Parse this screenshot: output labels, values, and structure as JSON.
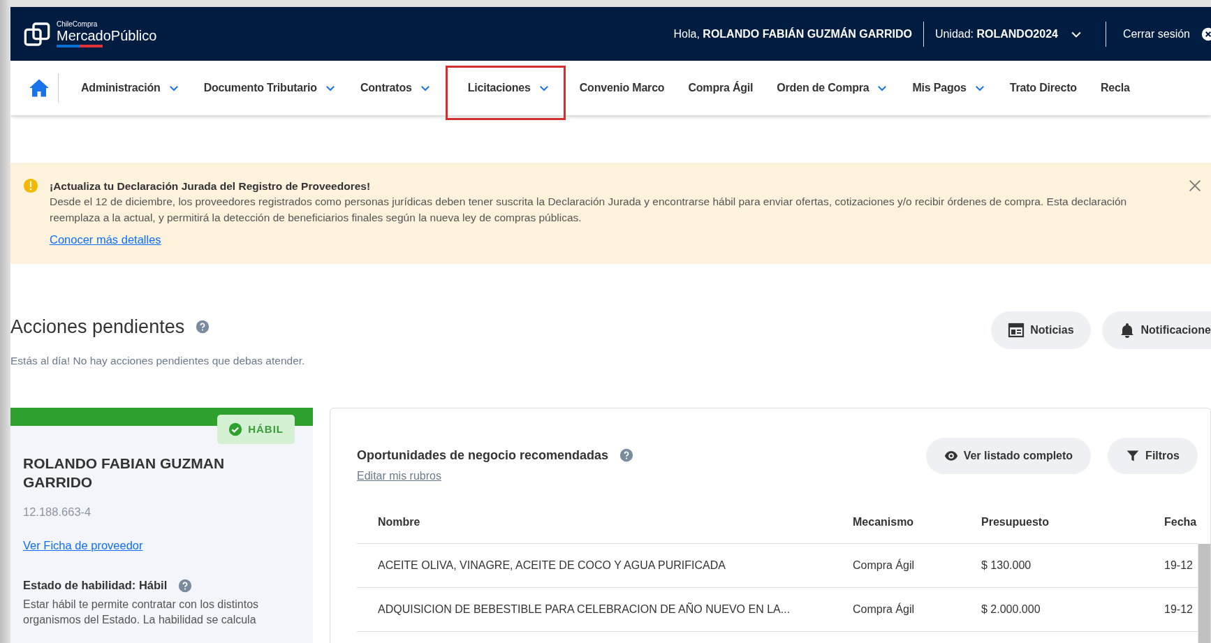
{
  "header": {
    "logo_top": "ChileCompra",
    "logo_name": "MercadoPúblico",
    "greeting": "Hola,",
    "user": "ROLANDO FABIÁN GUZMÁN GARRIDO",
    "unit_label": "Unidad:",
    "unit": "ROLANDO2024",
    "logout": "Cerrar sesión"
  },
  "nav": {
    "items": [
      {
        "label": "Administración",
        "dropdown": true,
        "highlighted": false
      },
      {
        "label": "Documento Tributario",
        "dropdown": true,
        "highlighted": false
      },
      {
        "label": "Contratos",
        "dropdown": true,
        "highlighted": false
      },
      {
        "label": "Licitaciones",
        "dropdown": true,
        "highlighted": true
      },
      {
        "label": "Convenio Marco",
        "dropdown": false,
        "highlighted": false
      },
      {
        "label": "Compra Ágil",
        "dropdown": false,
        "highlighted": false
      },
      {
        "label": "Orden de Compra",
        "dropdown": true,
        "highlighted": false
      },
      {
        "label": "Mis Pagos",
        "dropdown": true,
        "highlighted": false
      },
      {
        "label": "Trato Directo",
        "dropdown": false,
        "highlighted": false
      },
      {
        "label": "Recla",
        "dropdown": false,
        "highlighted": false
      }
    ]
  },
  "alert": {
    "title": "¡Actualiza tu Declaración Jurada del Registro de Proveedores!",
    "text": "Desde el 12 de diciembre, los proveedores registrados como personas jurídicas deben tener suscrita la Declaración Jurada y encontrarse hábil para enviar ofertas, cotizaciones y/o recibir órdenes de compra. Esta declaración reemplaza a la actual, y permitirá la detección de beneficiarios finales según la nueva ley de compras públicas.",
    "link": "Conocer más detalles"
  },
  "pending": {
    "title": "Acciones pendientes",
    "message": "Estás al día! No hay acciones pendientes que debas atender.",
    "buttons": [
      {
        "kind": "calendar",
        "label": "Noticias"
      },
      {
        "kind": "bell",
        "label": "Notificacione"
      }
    ]
  },
  "provider": {
    "status": "HÁBIL",
    "name": "ROLANDO FABIAN GUZMAN GARRIDO",
    "rut": "12.188.663-4",
    "link": "Ver Ficha de proveedor",
    "status_title": "Estado de habilidad: Hábil",
    "description": "Estar hábil te permite contratar con los distintos organismos del Estado. La habilidad se calcula"
  },
  "opportunities": {
    "title": "Oportunidades de negocio recomendadas",
    "edit_link": "Editar mis rubros",
    "buttons": [
      {
        "kind": "eye",
        "label": "Ver listado completo"
      },
      {
        "kind": "filter",
        "label": "Filtros"
      }
    ],
    "table": {
      "columns": [
        "Nombre",
        "Mecanismo",
        "Presupuesto",
        "Fecha"
      ],
      "rows": [
        [
          "ACEITE OLIVA, VINAGRE, ACEITE DE COCO Y AGUA PURIFICADA",
          "Compra Ágil",
          "$ 130.000",
          "19-12"
        ],
        [
          "ADQUISICION DE BEBESTIBLE PARA CELEBRACION DE AÑO NUEVO EN LA...",
          "Compra Ágil",
          "$ 2.000.000",
          "19-12"
        ]
      ]
    }
  }
}
